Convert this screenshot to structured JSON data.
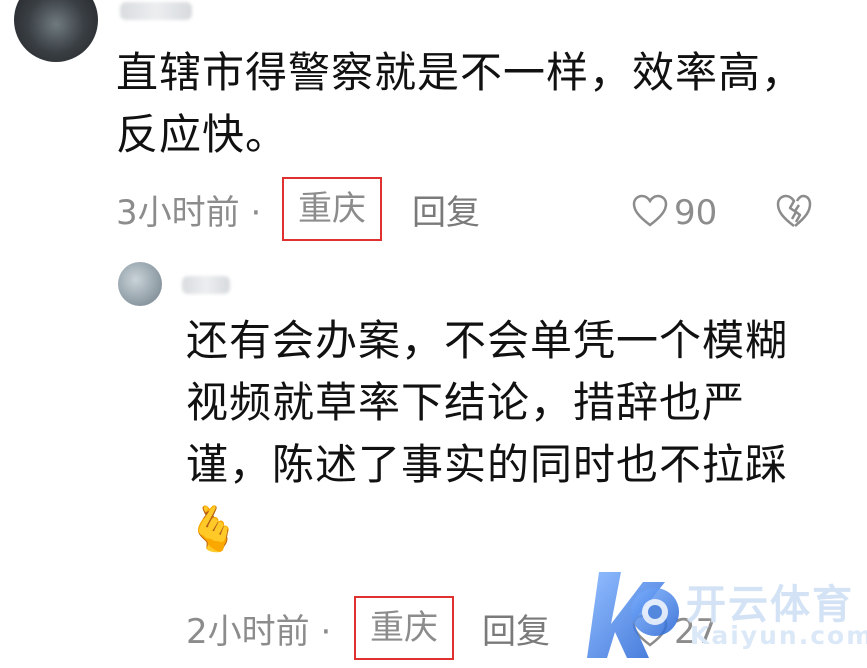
{
  "comment": {
    "text": "直辖市得警察就是不一样，效率高，反应快。",
    "time": "3小时前",
    "separator": "·",
    "location": "重庆",
    "reply_label": "回复",
    "like_count": "90"
  },
  "reply": {
    "text": "还有会办案，不会单凭一个模糊视频就草率下结论，措辞也严谨，陈述了事实的同时也不拉踩",
    "emoji": "🫰",
    "time": "2小时前",
    "separator": "·",
    "location": "重庆",
    "reply_label": "回复",
    "like_count": "27"
  },
  "watermark": {
    "title": "开云体育",
    "subtitle": "Kaiyun.com"
  },
  "icons": {
    "like": "heart-outline-icon",
    "dislike": "broken-heart-icon"
  },
  "colors": {
    "highlight_box": "#e03131",
    "meta_text": "#8c8c8c",
    "watermark_blue": "#2f6fd6"
  }
}
